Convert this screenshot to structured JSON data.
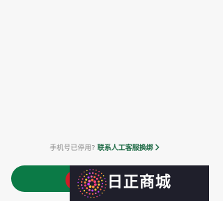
{
  "help": {
    "prompt": "手机号已停用?",
    "link": "联系人工客服换绑"
  },
  "primary_button": {
    "label": ""
  },
  "watermark": {
    "text": "日正商城"
  },
  "colors": {
    "background": "#f7f7f7",
    "brand_green": "#0b7a46",
    "link_green": "#1f6b46",
    "watermark_bg": "#1f1f2b",
    "accent_red": "#d01d27"
  },
  "icons": {
    "help_chevron": "chevron-right-icon",
    "watermark_logo": "dot-burst-icon"
  }
}
